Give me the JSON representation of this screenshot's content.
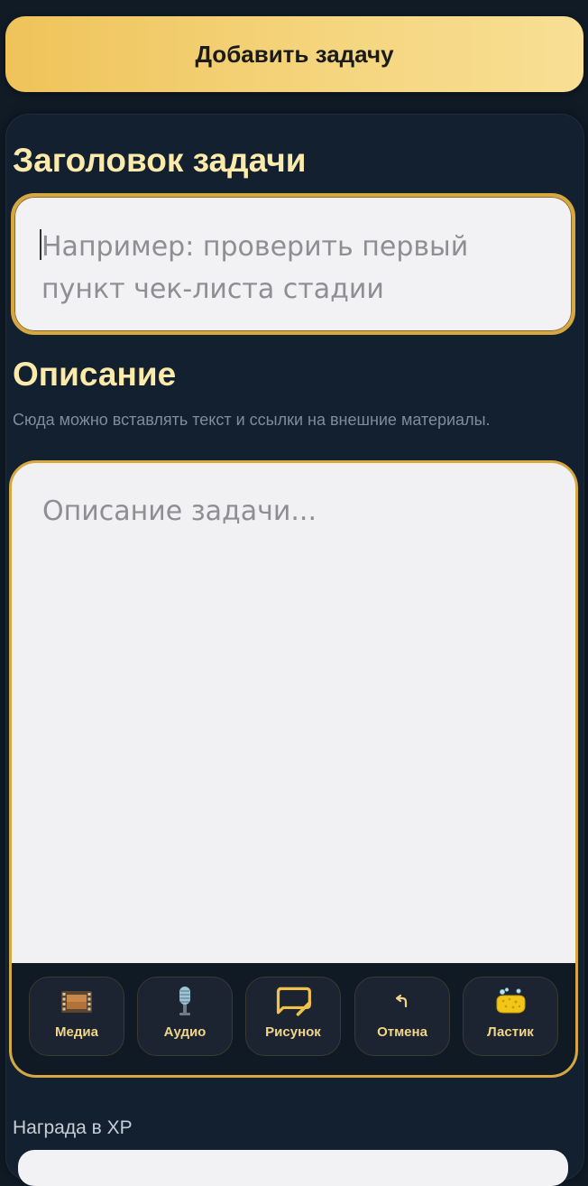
{
  "top_button": {
    "label": "Добавить задачу"
  },
  "form": {
    "title_heading": "Заголовок задачи",
    "title_placeholder": "Например: проверить первый пункт чек-листа стадии",
    "description_heading": "Описание",
    "description_hint": "Сюда можно вставлять текст и ссылки на внешние материалы.",
    "description_placeholder": "Описание задачи...",
    "reward_label": "Награда в XP"
  },
  "toolbar": {
    "items": [
      {
        "label": "Медиа",
        "icon": "film-icon"
      },
      {
        "label": "Аудио",
        "icon": "microphone-icon"
      },
      {
        "label": "Рисунок",
        "icon": "drawing-icon"
      },
      {
        "label": "Отмена",
        "icon": "undo-icon"
      },
      {
        "label": "Ластик",
        "icon": "sponge-icon"
      }
    ]
  },
  "colors": {
    "background": "#101b26",
    "accent_gold": "#d6a83f",
    "heading_text": "#fbeaa9"
  }
}
